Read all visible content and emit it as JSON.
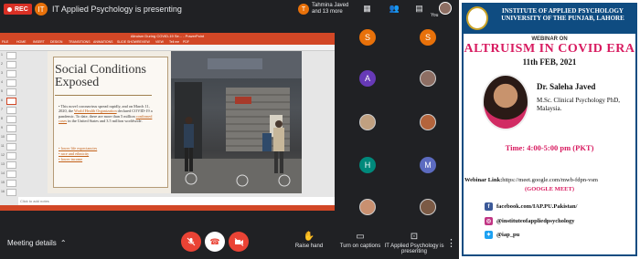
{
  "meet": {
    "rec_label": "REC",
    "presenter_initial": "IT",
    "presenting_text": "IT Applied Psychology is presenting",
    "join_notice": {
      "initial": "T",
      "text": "Tahmina Javed and 13 more"
    },
    "you_label": "You",
    "participants": [
      {
        "initial": "S",
        "color": "#e8710a"
      },
      {
        "initial": "S",
        "color": "#e8710a"
      },
      {
        "initial": "A",
        "color": "#673ab7"
      },
      {
        "initial": "",
        "color": "#8d6e63"
      },
      {
        "initial": "",
        "color": "#c0a080"
      },
      {
        "initial": "",
        "color": "#b3643c"
      },
      {
        "initial": "H",
        "color": "#00897b"
      },
      {
        "initial": "M",
        "color": "#5c6bc0"
      },
      {
        "initial": "",
        "color": "#c99070"
      },
      {
        "initial": "",
        "color": "#7b5a45"
      }
    ],
    "meeting_details": "Meeting details",
    "raise_hand": "Raise hand",
    "captions": "Turn on captions",
    "presenting_action": "IT Applied Psychology is presenting"
  },
  "ppt": {
    "window_title": "Altruism During COVID-19 Se... - PowerPoint",
    "ribbon": [
      "FILE",
      "HOME",
      "INSERT",
      "DESIGN",
      "TRANSITIONS",
      "ANIMATIONS",
      "SLIDE SHOW",
      "REVIEW",
      "VIEW",
      "Tell me",
      "PDF"
    ],
    "notes_placeholder": "Click to add notes",
    "thumb_numbers": [
      "1",
      "2",
      "3",
      "4",
      "5",
      "6",
      "7",
      "8",
      "9",
      "10",
      "11",
      "12",
      "13",
      "14",
      "15",
      "16"
    ],
    "slide": {
      "title": "Social Conditions Exposed",
      "body_prefix": "This novel coronavirus spread rapidly, and on March 11, 2020, the",
      "body_link1": "World Health Organization",
      "body_mid": "declared COVID-19 a pandemic. To date, there are more than 5 million",
      "body_link2": "confirmed cases",
      "body_suffix": "in the United States and 3.5 million worldwide.",
      "bullets": [
        "lower life expectancies",
        "race and ethnicity",
        "lower income"
      ]
    }
  },
  "poster": {
    "institute": "INSTITUTE OF APPLIED PSYCHOLOGY UNIVERSITY OF THE PUNJAB, LAHORE",
    "webinar_on": "WEBINAR ON",
    "topic": "ALTRUISM IN COVID ERA",
    "date": "11th FEB, 2021",
    "speaker": "Dr. Saleha Javed",
    "qualifications": "M.Sc. Clinical Psychology PhD, Malaysia.",
    "time": "Time: 4:00-5:00 pm (PKT)",
    "link_label": "Webinar Link:",
    "link_url": "https://meet.google.com/mwb-fdpn-vsm",
    "meet_tag": "(GOOGLE MEET)",
    "socials": [
      {
        "icon": "facebook-icon",
        "glyph": "f",
        "color": "#3b5998",
        "text": "facebook.com/IAP.PU.Pakistan/"
      },
      {
        "icon": "instagram-icon",
        "glyph": "◎",
        "color": "#c13584",
        "text": "@instituteofappliedpsychology"
      },
      {
        "icon": "twitter-icon",
        "glyph": "✦",
        "color": "#1da1f2",
        "text": "@iap_pu"
      }
    ]
  }
}
